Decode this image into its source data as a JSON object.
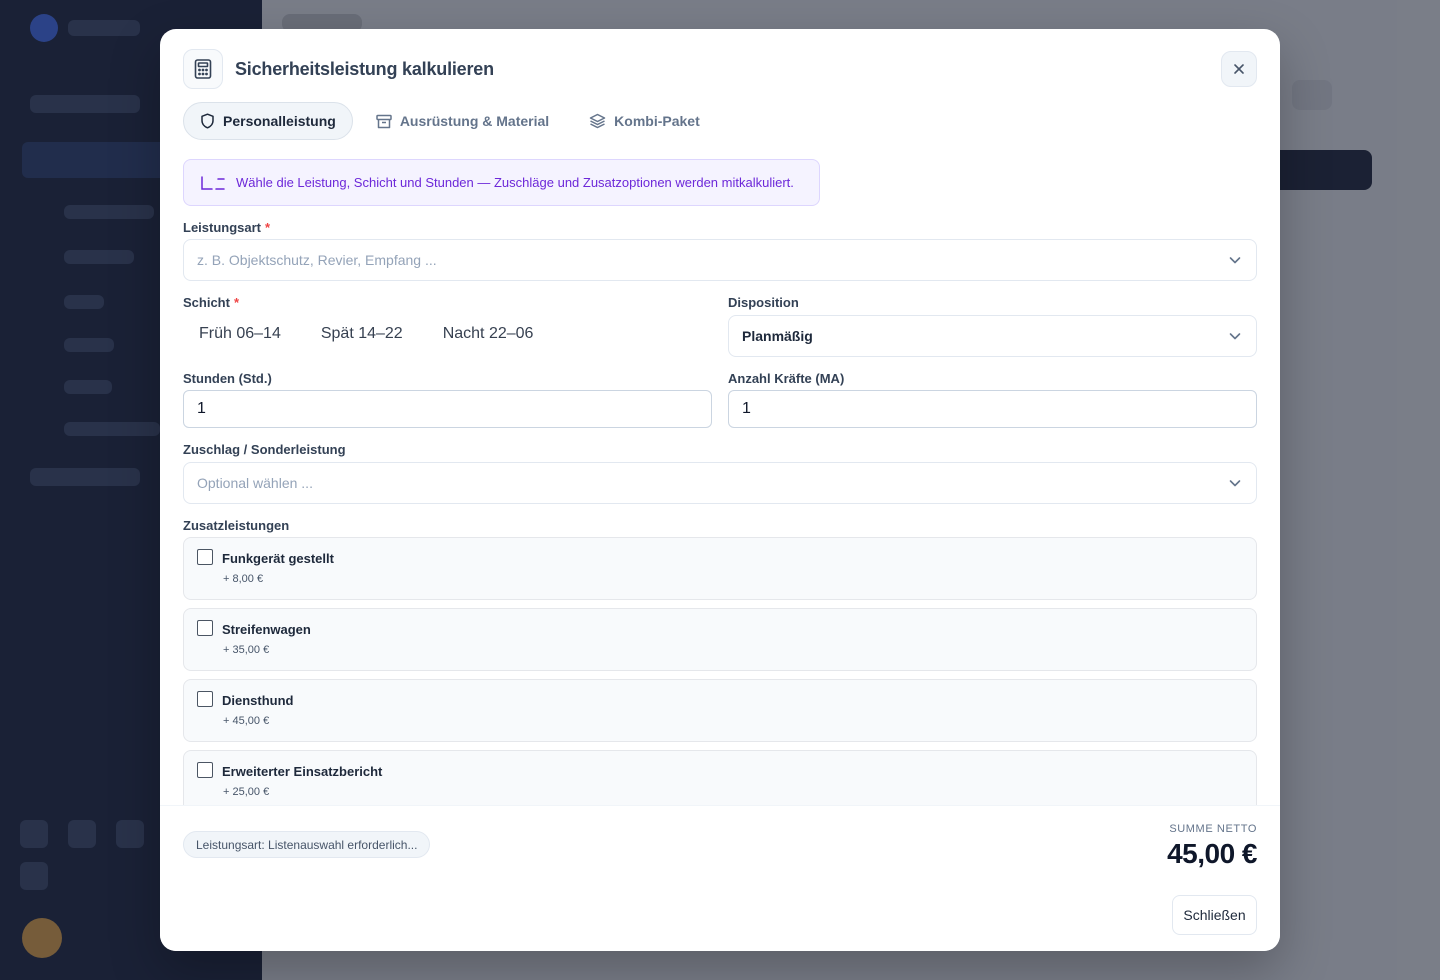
{
  "modal": {
    "title": "Sicherheitsleistung kalkulieren",
    "close_icon": "close-icon"
  },
  "tabs": [
    {
      "label": "Personalleistung",
      "icon": "shield-icon",
      "active": true
    },
    {
      "label": "Ausrüstung & Material",
      "icon": "box-icon",
      "active": false
    },
    {
      "label": "Kombi-Paket",
      "icon": "layers-icon",
      "active": false
    }
  ],
  "info": {
    "text": "Wähle die Leistung, Schicht und Stunden — Zuschläge und Zusatzoptionen werden mitkalkuliert."
  },
  "form": {
    "leistungsart": {
      "label": "Leistungsart",
      "required": "*",
      "placeholder": "z. B. Objektschutz, Revier, Empfang ..."
    },
    "schicht": {
      "label": "Schicht",
      "required": "*",
      "options": [
        "Früh 06–14",
        "Spät 14–22",
        "Nacht 22–06"
      ]
    },
    "disposition": {
      "label": "Disposition",
      "value": "Planmäßig"
    },
    "stunden": {
      "label": "Stunden (Std.)",
      "value": "1"
    },
    "kraefte": {
      "label": "Anzahl Kräfte (MA)",
      "value": "1"
    },
    "zuschlag": {
      "label": "Zuschlag / Sonderleistung",
      "placeholder": "Optional wählen ..."
    },
    "zusatz": {
      "label": "Zusatzleistungen",
      "items": [
        {
          "name": "Funkgerät gestellt",
          "price": "+ 8,00 €",
          "checked": false
        },
        {
          "name": "Streifenwagen",
          "price": "+ 35,00 €",
          "checked": false
        },
        {
          "name": "Diensthund",
          "price": "+ 45,00 €",
          "checked": false
        },
        {
          "name": "Erweiterter Einsatzbericht",
          "price": "+ 25,00 €",
          "checked": false
        }
      ]
    }
  },
  "footer": {
    "status": "Leistungsart: Listenauswahl erforderlich...",
    "sum_label": "SUMME NETTO",
    "sum_value": "45,00 €",
    "close_label": "Schließen"
  },
  "colors": {
    "accent_purple": "#6d28d9",
    "info_bg": "#f5f3ff",
    "required": "#ef4444",
    "sidebar_bg": "#1a2238"
  }
}
